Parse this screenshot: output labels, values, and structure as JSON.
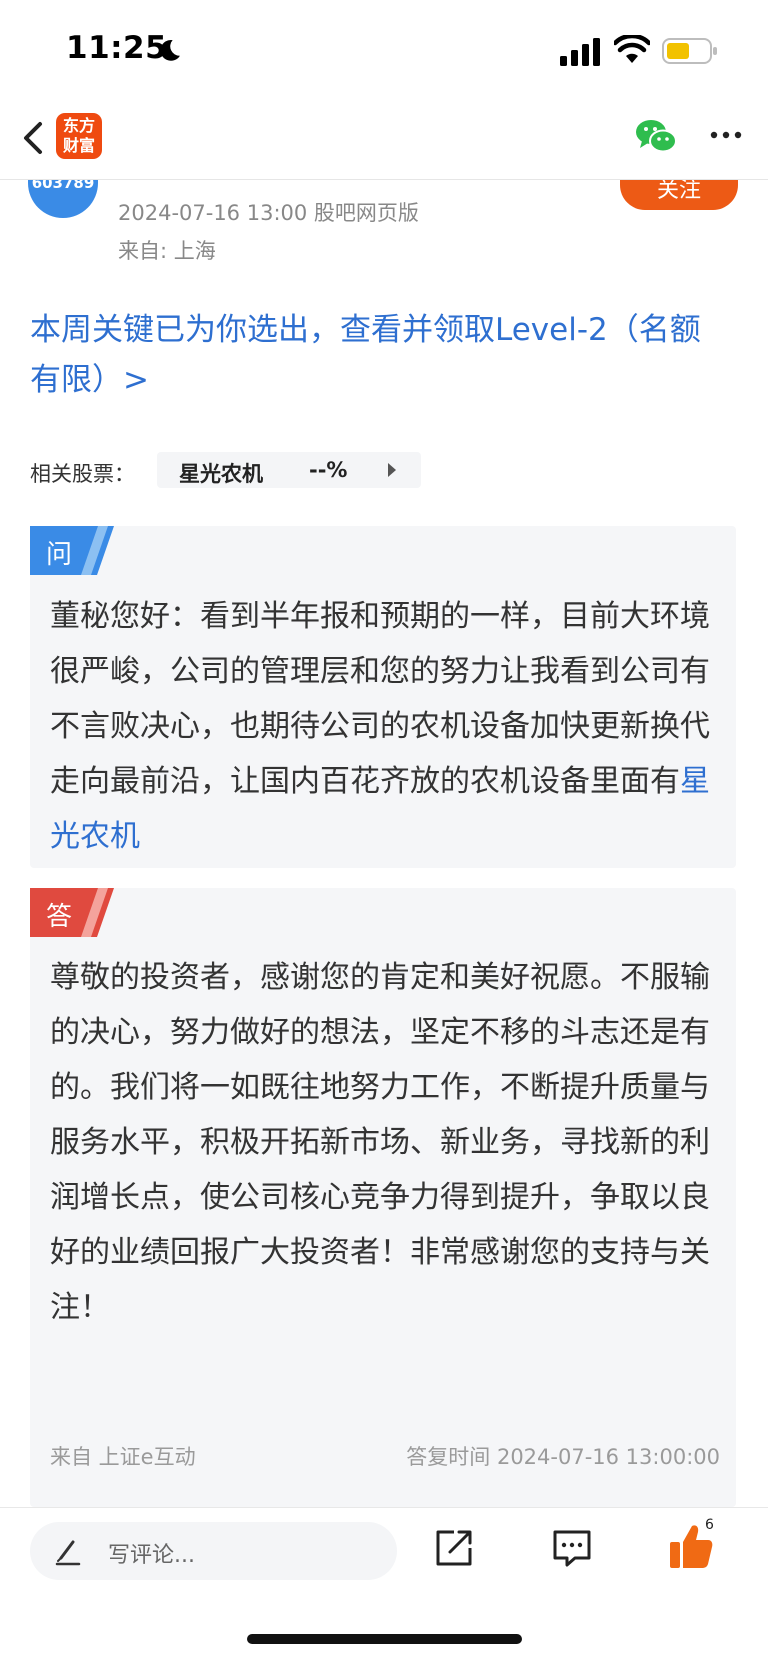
{
  "status_bar": {
    "time": "11:25"
  },
  "nav": {
    "logo_line1": "东方",
    "logo_line2": "财富"
  },
  "author": {
    "avatar_code": "603789",
    "follow_label": "关注",
    "meta": "2024-07-16 13:00 股吧网页版",
    "from": "来自: 上海"
  },
  "promo": {
    "text": "本周关键已为你选出，查看并领取Level-2（名额有限）>"
  },
  "related": {
    "label": "相关股票：",
    "stock_name": "星光农机",
    "stock_change": "--%"
  },
  "question": {
    "tag": "问",
    "text": "董秘您好：看到半年报和预期的一样，目前大环境很严峻，公司的管理层和您的努力让我看到公司有不言败决心，也期待公司的农机设备加快更新换代走向最前沿，让国内百花齐放的农机设备里面有",
    "highlight": "星光农机"
  },
  "answer": {
    "tag": "答",
    "text": "尊敬的投资者，感谢您的肯定和美好祝愿。不服输的决心，努力做好的想法，坚定不移的斗志还是有的。我们将一如既往地努力工作，不断提升质量与服务水平，积极开拓新市场、新业务，寻找新的利润增长点，使公司核心竞争力得到提升，争取以良好的业绩回报广大投资者！非常感谢您的支持与关注！",
    "source": "来自 上证e互动",
    "reply_time": "答复时间 2024-07-16 13:00:00"
  },
  "bottom_bar": {
    "comment_placeholder": "写评论...",
    "like_count": "6"
  },
  "colors": {
    "accent_blue": "#2e6fd0",
    "brand_orange": "#ef4a10",
    "answer_red": "#e04a3f",
    "question_blue": "#3a8be6"
  },
  "icons": [
    "back-chevron-icon",
    "wechat-icon",
    "more-icon",
    "pen-icon",
    "share-icon",
    "comment-bubble-icon",
    "thumbs-up-icon",
    "moon-icon",
    "signal-icon",
    "wifi-icon",
    "battery-icon"
  ]
}
